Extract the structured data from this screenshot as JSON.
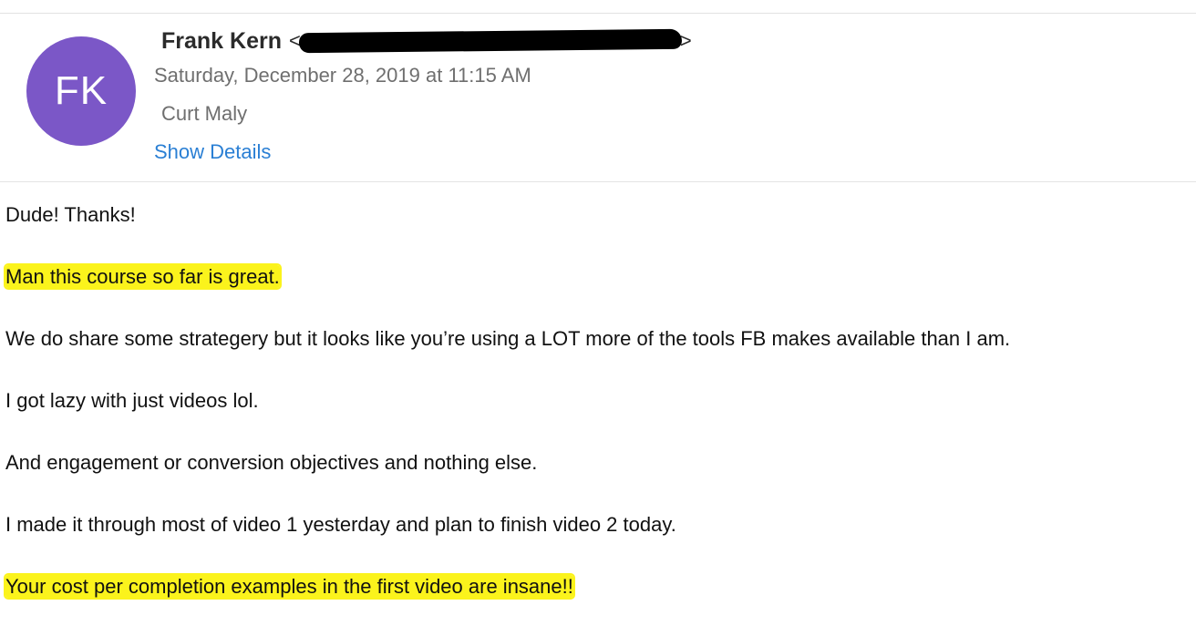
{
  "message": {
    "avatar_initials": "FK",
    "sender_name": "Frank Kern",
    "sender_email_open": "<",
    "sender_email_close": ">",
    "date": "Saturday, December 28, 2019 at 11:15 AM",
    "recipient": "Curt Maly",
    "show_details_label": "Show Details",
    "body": [
      "Dude! Thanks!",
      "Man this course so far is great.",
      "We do share some strategery but it looks like you’re using a LOT more of the tools FB makes available than I am.",
      "I got lazy with just videos lol.",
      "And engagement or conversion objectives and nothing else.",
      "I made it through most of video 1 yesterday and plan to finish video 2 today.",
      "Your cost per completion examples in the first video are insane!!"
    ]
  },
  "colors": {
    "avatar_bg": "#7b57c7",
    "link": "#2a7fd4",
    "highlight": "#fbf31c",
    "redaction": "#000000"
  }
}
